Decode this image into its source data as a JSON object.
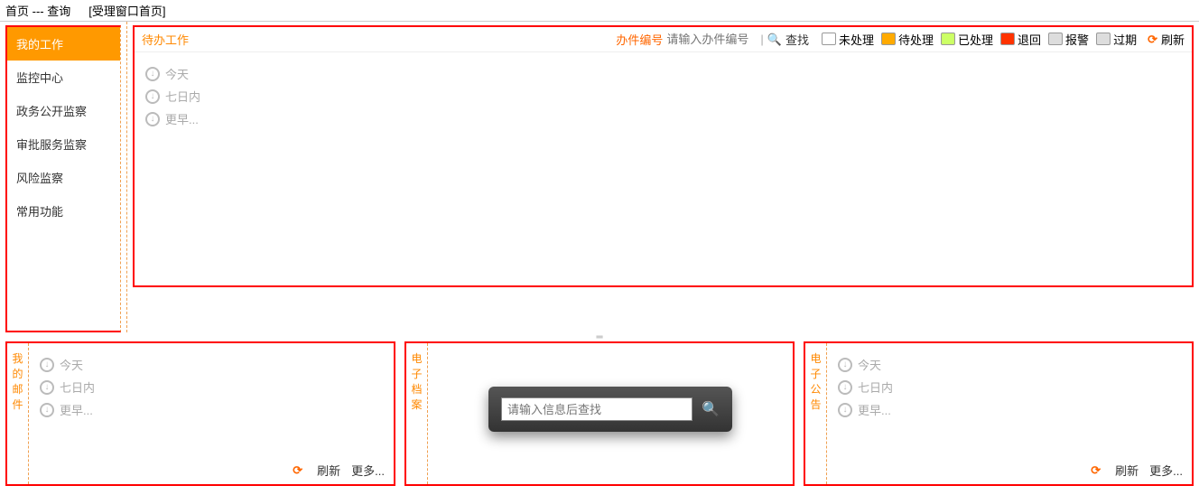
{
  "breadcrumb": "首页 --- 查询",
  "page_title": "[受理窗口首页]",
  "sidebar": {
    "items": [
      {
        "label": "我的工作",
        "active": true
      },
      {
        "label": "监控中心"
      },
      {
        "label": "政务公开监察"
      },
      {
        "label": "审批服务监察"
      },
      {
        "label": "风险监察"
      },
      {
        "label": "常用功能"
      }
    ]
  },
  "todo": {
    "title": "待办工作",
    "search_label": "办件编号",
    "search_placeholder": "请输入办件编号",
    "search_button": "查找",
    "statuses": [
      {
        "label": "未处理",
        "color": "#ffffff"
      },
      {
        "label": "待处理",
        "color": "#ffaa00"
      },
      {
        "label": "已处理",
        "color": "#ccff66"
      },
      {
        "label": "退回",
        "color": "#ff3300"
      },
      {
        "label": "报警",
        "color": "#dddddd"
      },
      {
        "label": "过期",
        "color": "#dddddd"
      }
    ],
    "refresh": "刷新",
    "groups": [
      "今天",
      "七日内",
      "更早..."
    ]
  },
  "bottom": {
    "mail": {
      "title": "我的邮件",
      "groups": [
        "今天",
        "七日内",
        "更早..."
      ],
      "refresh": "刷新",
      "more": "更多..."
    },
    "archive": {
      "title": "电子档案",
      "placeholder": "请输入信息后查找"
    },
    "notice": {
      "title": "电子公告",
      "groups": [
        "今天",
        "七日内",
        "更早..."
      ],
      "refresh": "刷新",
      "more": "更多..."
    }
  }
}
